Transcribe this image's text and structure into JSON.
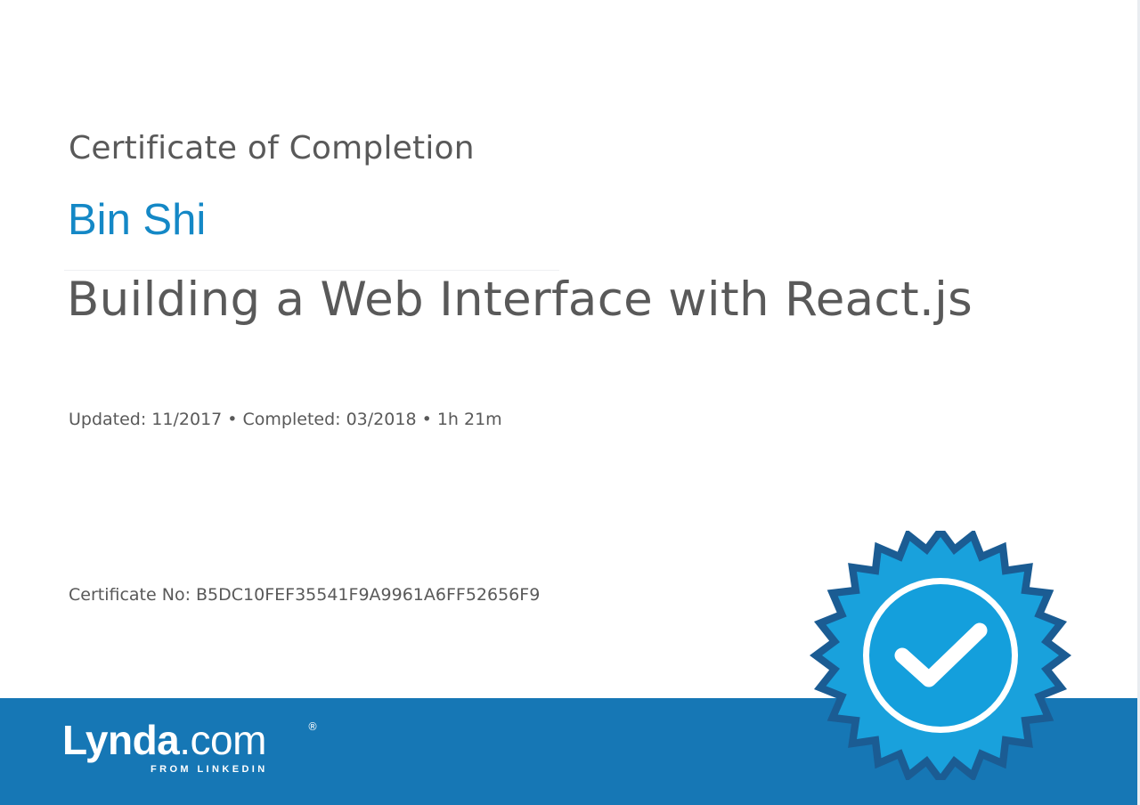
{
  "certificate": {
    "heading": "Certificate of Completion",
    "recipient": "Bin Shi",
    "course_title": "Building a Web Interface with React.js",
    "meta": "Updated: 11/2017 • Completed: 03/2018 • 1h 21m",
    "certificate_number": "Certificate No: B5DC10FEF35541F9A9961A6FF52656F9"
  },
  "branding": {
    "logo_brand": "Lynda",
    "logo_tld": ".com",
    "logo_registered": "®",
    "tagline": "FROM LINKEDIN"
  },
  "badge": {
    "icon": "checkmark-seal-icon"
  },
  "colors": {
    "accent_blue": "#1488c6",
    "footer_blue": "#1677b5",
    "text_gray": "#595959",
    "badge_light": "#19a1dc",
    "badge_dark": "#1b5c93"
  }
}
